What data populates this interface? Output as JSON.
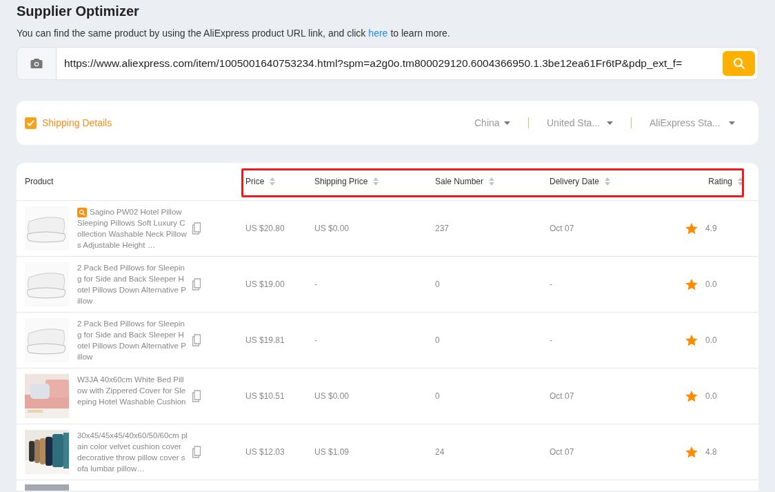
{
  "title": "Supplier Optimizer",
  "description": {
    "text": "You can find the same product by using the AliExpress product URL link, and click",
    "link": "here",
    "after": "to learn more."
  },
  "search": {
    "value": "https://www.aliexpress.com/item/1005001640753234.html?spm=a2g0o.tm800029120.6004366950.1.3be12ea61Fr6tP&pdp_ext_f="
  },
  "shipping": {
    "label": "Shipping Details",
    "checked": true,
    "dropdowns": [
      "China",
      "United Sta...",
      "AliExpress Sta..."
    ]
  },
  "table": {
    "columns": [
      "Product",
      "Price",
      "Shipping Price",
      "Sale Number",
      "Delivery Date",
      "Rating"
    ],
    "highlighted": true,
    "rows": [
      {
        "kind": "product",
        "badge": true,
        "title": "Sagino PW02 Hotel Pillow Sleeping Pillows Soft Luxury Collection Washable Neck Pillows Adjustable Height …",
        "price": "US $20.80",
        "shipping": "US $0.00",
        "sales": "237",
        "delivery": "Oct 07",
        "rating": "4.9"
      },
      {
        "kind": "product",
        "badge": false,
        "title": "2 Pack Bed Pillows for Sleeping for Side and Back Sleeper Hotel Pillows Down Alternative Pillow",
        "price": "US $19.00",
        "shipping": "-",
        "sales": "0",
        "delivery": "-",
        "rating": "0.0"
      },
      {
        "kind": "product",
        "badge": false,
        "title": "2 Pack Bed Pillows for Sleeping for Side and Back Sleeper Hotel Pillows Down Alternative Pillow",
        "price": "US $19.81",
        "shipping": "-",
        "sales": "0",
        "delivery": "-",
        "rating": "0.0"
      },
      {
        "kind": "product",
        "badge": false,
        "title": "W3JA 40x60cm White Bed Pillow with Zippered Cover for Sleeping Hotel Washable Cushion",
        "price": "US $10.51",
        "shipping": "US $0.00",
        "sales": "0",
        "delivery": "Oct 07",
        "rating": "0.0"
      },
      {
        "kind": "product",
        "badge": false,
        "title": "30x45/45x45/40x60/50/60cm plain color velvet cushion cover decorative throw pillow cover sofa lumbar pillow…",
        "price": "US $12.03",
        "shipping": "US $1.09",
        "sales": "24",
        "delivery": "Oct 07",
        "rating": "4.8"
      },
      {
        "kind": "cut_off"
      }
    ]
  }
}
